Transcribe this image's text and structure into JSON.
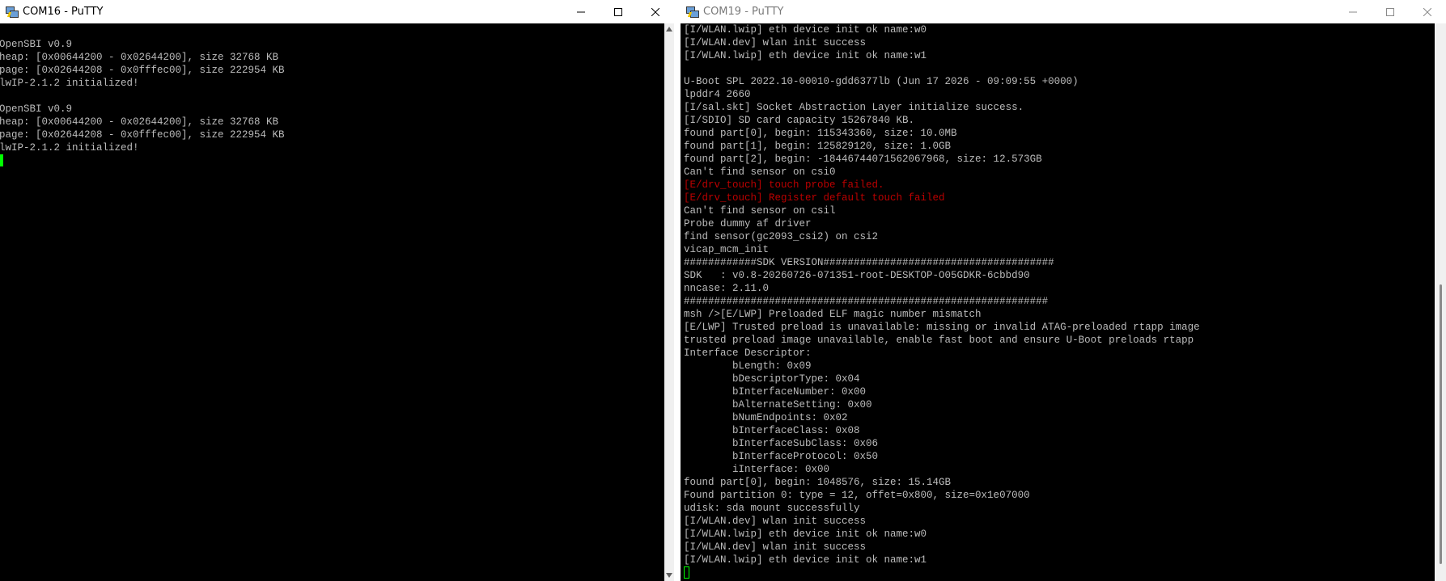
{
  "left_window": {
    "title": "COM16 - PuTTY",
    "lines": [
      "OpenSBI v0.9",
      "heap: [0x00644200 - 0x02644200], size 32768 KB",
      "page: [0x02644208 - 0x0fffec00], size 222954 KB",
      "lwIP-2.1.2 initialized!",
      "",
      "OpenSBI v0.9",
      "heap: [0x00644200 - 0x02644200], size 32768 KB",
      "page: [0x02644208 - 0x0fffec00], size 222954 KB",
      "lwIP-2.1.2 initialized!"
    ]
  },
  "right_window": {
    "title": "COM19 - PuTTY",
    "lines": [
      {
        "text": "[I/WLAN.lwip] eth device init ok name:w0",
        "color": "normal"
      },
      {
        "text": "[I/WLAN.dev] wlan init success",
        "color": "normal"
      },
      {
        "text": "[I/WLAN.lwip] eth device init ok name:w1",
        "color": "normal"
      },
      {
        "text": "",
        "color": "normal"
      },
      {
        "text": "U-Boot SPL 2022.10-00010-gdd6377lb (Jun 17 2026 - 09:09:55 +0000)",
        "color": "normal"
      },
      {
        "text": "lpddr4 2660",
        "color": "normal"
      },
      {
        "text": "[I/sal.skt] Socket Abstraction Layer initialize success.",
        "color": "normal"
      },
      {
        "text": "[I/SDIO] SD card capacity 15267840 KB.",
        "color": "normal"
      },
      {
        "text": "found part[0], begin: 115343360, size: 10.0MB",
        "color": "normal"
      },
      {
        "text": "found part[1], begin: 125829120, size: 1.0GB",
        "color": "normal"
      },
      {
        "text": "found part[2], begin: -18446744071562067968, size: 12.573GB",
        "color": "normal"
      },
      {
        "text": "Can't find sensor on csi0",
        "color": "normal"
      },
      {
        "text": "[E/drv_touch] touch probe failed.",
        "color": "error"
      },
      {
        "text": "[E/drv_touch] Register default touch failed",
        "color": "error"
      },
      {
        "text": "Can't find sensor on csil",
        "color": "normal"
      },
      {
        "text": "Probe dummy af driver",
        "color": "normal"
      },
      {
        "text": "find sensor(gc2093_csi2) on csi2",
        "color": "normal"
      },
      {
        "text": "vicap_mcm_init",
        "color": "normal"
      },
      {
        "text": "############SDK VERSION######################################",
        "color": "normal"
      },
      {
        "text": "SDK   : v0.8-20260726-071351-root-DESKTOP-O05GDKR-6cbbd90",
        "color": "normal"
      },
      {
        "text": "nncase: 2.11.0",
        "color": "normal"
      },
      {
        "text": "############################################################",
        "color": "normal"
      },
      {
        "text": "msh />[E/LWP] Preloaded ELF magic number mismatch",
        "color": "normal"
      },
      {
        "text": "[E/LWP] Trusted preload is unavailable: missing or invalid ATAG-preloaded rtapp image",
        "color": "normal"
      },
      {
        "text": "trusted preload image unavailable, enable fast boot and ensure U-Boot preloads rtapp",
        "color": "normal"
      },
      {
        "text": "Interface Descriptor:",
        "color": "normal"
      },
      {
        "text": "        bLength: 0x09",
        "color": "normal"
      },
      {
        "text": "        bDescriptorType: 0x04",
        "color": "normal"
      },
      {
        "text": "        bInterfaceNumber: 0x00",
        "color": "normal"
      },
      {
        "text": "        bAlternateSetting: 0x00",
        "color": "normal"
      },
      {
        "text": "        bNumEndpoints: 0x02",
        "color": "normal"
      },
      {
        "text": "        bInterfaceClass: 0x08",
        "color": "normal"
      },
      {
        "text": "        bInterfaceSubClass: 0x06",
        "color": "normal"
      },
      {
        "text": "        bInterfaceProtocol: 0x50",
        "color": "normal"
      },
      {
        "text": "        iInterface: 0x00",
        "color": "normal"
      },
      {
        "text": "found part[0], begin: 1048576, size: 15.14GB",
        "color": "normal"
      },
      {
        "text": "Found partition 0: type = 12, offet=0x800, size=0x1e07000",
        "color": "normal"
      },
      {
        "text": "udisk: sda mount successfully",
        "color": "normal"
      },
      {
        "text": "[I/WLAN.dev] wlan init success",
        "color": "normal"
      },
      {
        "text": "[I/WLAN.lwip] eth device init ok name:w0",
        "color": "normal"
      },
      {
        "text": "[I/WLAN.dev] wlan init success",
        "color": "normal"
      },
      {
        "text": "[I/WLAN.lwip] eth device init ok name:w1",
        "color": "normal"
      }
    ]
  },
  "colors": {
    "terminal_bg": "#000000",
    "terminal_text": "#bbbbbb",
    "error_text": "#bb0000",
    "cursor": "#00ff00",
    "titlebar_bg": "#ffffff"
  },
  "icons": {
    "app": "putty-icon",
    "minimize": "minimize-icon",
    "maximize": "maximize-icon",
    "close": "close-icon"
  }
}
